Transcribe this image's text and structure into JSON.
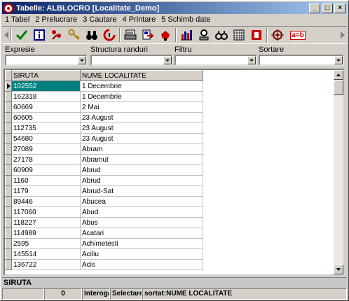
{
  "window": {
    "title": "Tabelle: ALBLOCRO [Localitate_Demo]",
    "controls": [
      "_",
      "□",
      "×"
    ]
  },
  "menu": [
    "1 Tabel",
    "2 Prelucrare",
    "3 Cautare",
    "4 Printare",
    "5 Schimb date"
  ],
  "toolbar": {
    "icons": [
      "check-icon",
      "info-icon",
      "sort-icon",
      "key-icon",
      "binoculars-icon",
      "recycle-icon",
      "print-preview-icon",
      "export-icon",
      "brush-icon",
      "chart-icon",
      "magnifier-icon",
      "glasses-icon",
      "calculator-icon",
      "stop-icon",
      "target-icon",
      "replace-icon"
    ],
    "replace_label": "a=b"
  },
  "filters": {
    "expresie_label": "Expresie",
    "structura_label": "Structura randuri",
    "filtru_label": "Filtru",
    "sortare_label": "Sortare"
  },
  "grid": {
    "columns": [
      "SIRUTA",
      "NUME LOCALITATE"
    ],
    "rows": [
      [
        "102552",
        "1 Decembrie"
      ],
      [
        "162318",
        "1 Decembrie"
      ],
      [
        "60669",
        "2 Mai"
      ],
      [
        "60605",
        "23 August"
      ],
      [
        "112735",
        "23 August"
      ],
      [
        "54680",
        "23 August"
      ],
      [
        "27089",
        "Abram"
      ],
      [
        "27178",
        "Abramut"
      ],
      [
        "60909",
        "Abrud"
      ],
      [
        "1160",
        "Abrud"
      ],
      [
        "1179",
        "Abrud-Sat"
      ],
      [
        "89446",
        "Abucea"
      ],
      [
        "117060",
        "Abud"
      ],
      [
        "118227",
        "Abus"
      ],
      [
        "114989",
        "Acatari"
      ],
      [
        "2595",
        "Achimetesti"
      ],
      [
        "145514",
        "Aciliu"
      ],
      [
        "136722",
        "Acis"
      ]
    ],
    "selected_row": 0
  },
  "fieldbar": {
    "label": "SIRUTA"
  },
  "status": {
    "record": "0",
    "mode1": "Interoga",
    "mode2": "Selectare",
    "sort": "sortat:NUME LOCALITATE"
  }
}
